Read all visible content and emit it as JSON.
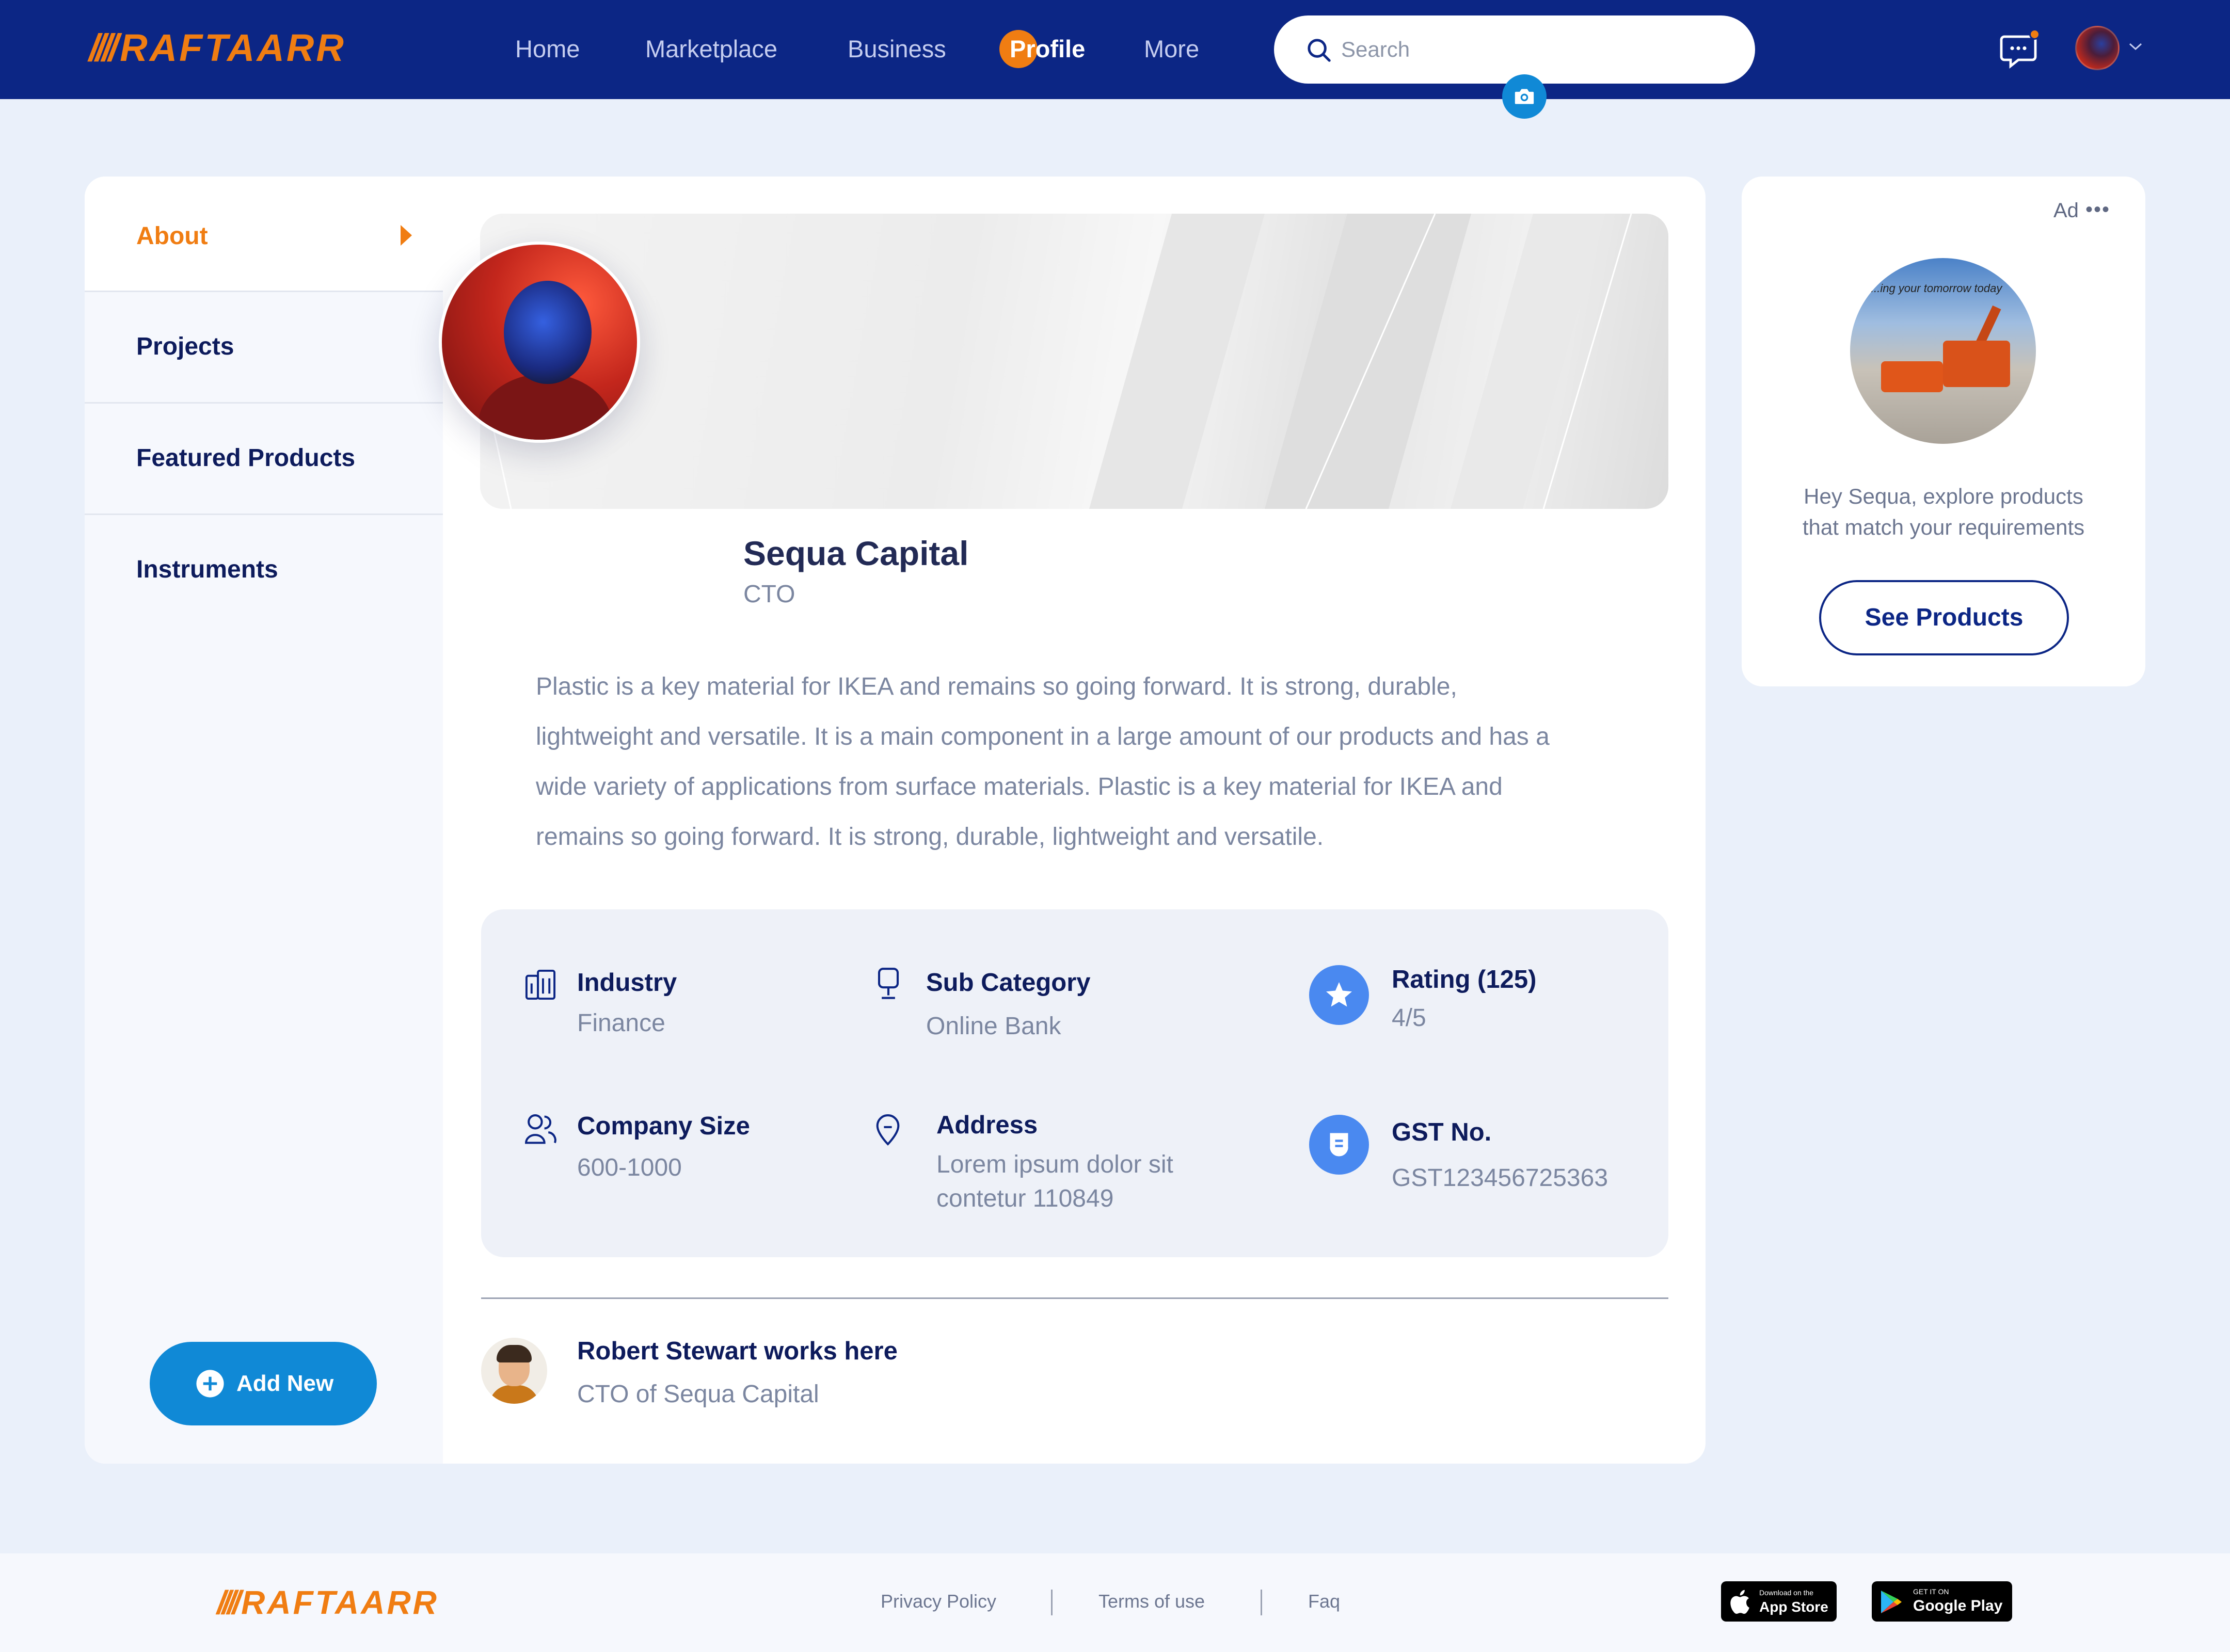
{
  "brand": {
    "name": "RAFTAARR",
    "stripes": "////"
  },
  "nav": {
    "links": [
      {
        "label": "Home",
        "active": false
      },
      {
        "label": "Marketplace",
        "active": false
      },
      {
        "label": "Business",
        "active": false
      },
      {
        "label": "Profile",
        "active": true
      },
      {
        "label": "More",
        "active": false
      }
    ],
    "search_placeholder": "Search",
    "icons": [
      "search-icon",
      "chat-icon",
      "avatar",
      "chevron-down-icon"
    ]
  },
  "sidebar": {
    "items": [
      {
        "label": "About",
        "active": true
      },
      {
        "label": "Projects",
        "active": false
      },
      {
        "label": "Featured Products",
        "active": false
      },
      {
        "label": "Instruments",
        "active": false
      }
    ],
    "add_new_label": "Add New"
  },
  "profile": {
    "name": "Sequa Capital",
    "role": "CTO",
    "about": "Plastic is a key material for IKEA and remains so going forward. It is strong, durable, lightweight and versatile. It is a main component in a large amount of our products and has a wide variety of applications from surface materials. Plastic is a key material for IKEA and remains so going forward. It is strong, durable, lightweight and versatile.",
    "about_lines": [
      "Plastic is a key material for IKEA and remains so going forward. It is strong, durable,",
      "lightweight and versatile. It is a main component in a large amount of our products and has a",
      "wide variety of applications from surface materials. Plastic is a key material for IKEA and",
      "remains so going forward. It is strong, durable, lightweight and versatile."
    ]
  },
  "info": {
    "industry": {
      "label": "Industry",
      "value": "Finance"
    },
    "sub_category": {
      "label": "Sub Category",
      "value": "Online Bank"
    },
    "rating": {
      "label": "Rating (125)",
      "value": "4/5"
    },
    "company_size": {
      "label": "Company Size",
      "value": "600-1000"
    },
    "address": {
      "label": "Address",
      "value_line1": "Lorem ipsum dolor sit",
      "value_line2": "contetur 110849"
    },
    "gst": {
      "label": "GST No.",
      "value": "GST123456725363"
    }
  },
  "worker": {
    "title": "Robert Stewart works here",
    "subtitle": "CTO of Sequa Capital"
  },
  "ad": {
    "label": "Ad",
    "dots": "•••",
    "image_tagline": "...ing your tomorrow today",
    "text_line1": "Hey Sequa, explore products",
    "text_line2": "that match your requirements",
    "button_label": "See Products"
  },
  "footer": {
    "links": [
      "Privacy Policy",
      "Terms of use",
      "Faq"
    ],
    "app_store": {
      "small": "Download on the",
      "big": "App Store"
    },
    "google_play": {
      "small": "GET IT ON",
      "big": "Google Play"
    }
  },
  "colors": {
    "navbar": "#0c2685",
    "brand_orange": "#f07d12",
    "accent_blue": "#1089d6",
    "icon_blue": "#4a89f0",
    "page_bg": "#eaf0fa"
  }
}
